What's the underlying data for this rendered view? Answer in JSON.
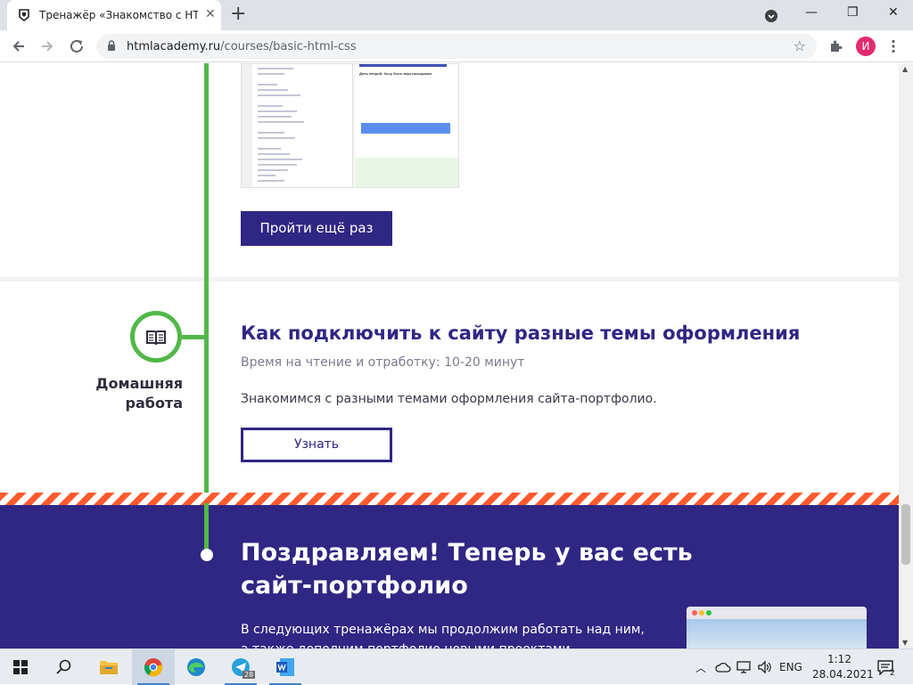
{
  "browser": {
    "tab_title": "Тренажёр «Знакомство с HTML",
    "tab_close": "✕",
    "new_tab": "+",
    "url_domain": "htmlacademy.ru",
    "url_path": "/courses/basic-html-css",
    "profile_initial": "И",
    "star_icon": "☆",
    "window_minimize": "—",
    "window_restore": "❐",
    "window_close": "✕"
  },
  "lesson_preview": {
    "heading": "День второй. Хочу быть верстальщиком"
  },
  "retry_button": "Пройти ещё раз",
  "homework": {
    "label_line1": "Домашняя",
    "label_line2": "работа",
    "title": "Как подключить к сайту разные темы оформления",
    "time": "Время на чтение и отработку: 10-20 минут",
    "description": "Знакомимся с разными темами оформления сайта-портфолио.",
    "button": "Узнать"
  },
  "finale": {
    "title_line1": "Поздравляем! Теперь у вас есть",
    "title_line2": "сайт-портфолио",
    "text_line1": "В следующих тренажёрах мы продолжим работать над ним,",
    "text_line2": "а также дополним портфолио новыми проектами."
  },
  "taskbar": {
    "language": "ENG",
    "time": "1:12",
    "date": "28.04.2021",
    "telegram_badge": "28",
    "notification_count": "2"
  },
  "colors": {
    "brand_purple": "#302683",
    "timeline_green": "#52b848",
    "stripe_orange": "#ff5a2d"
  }
}
